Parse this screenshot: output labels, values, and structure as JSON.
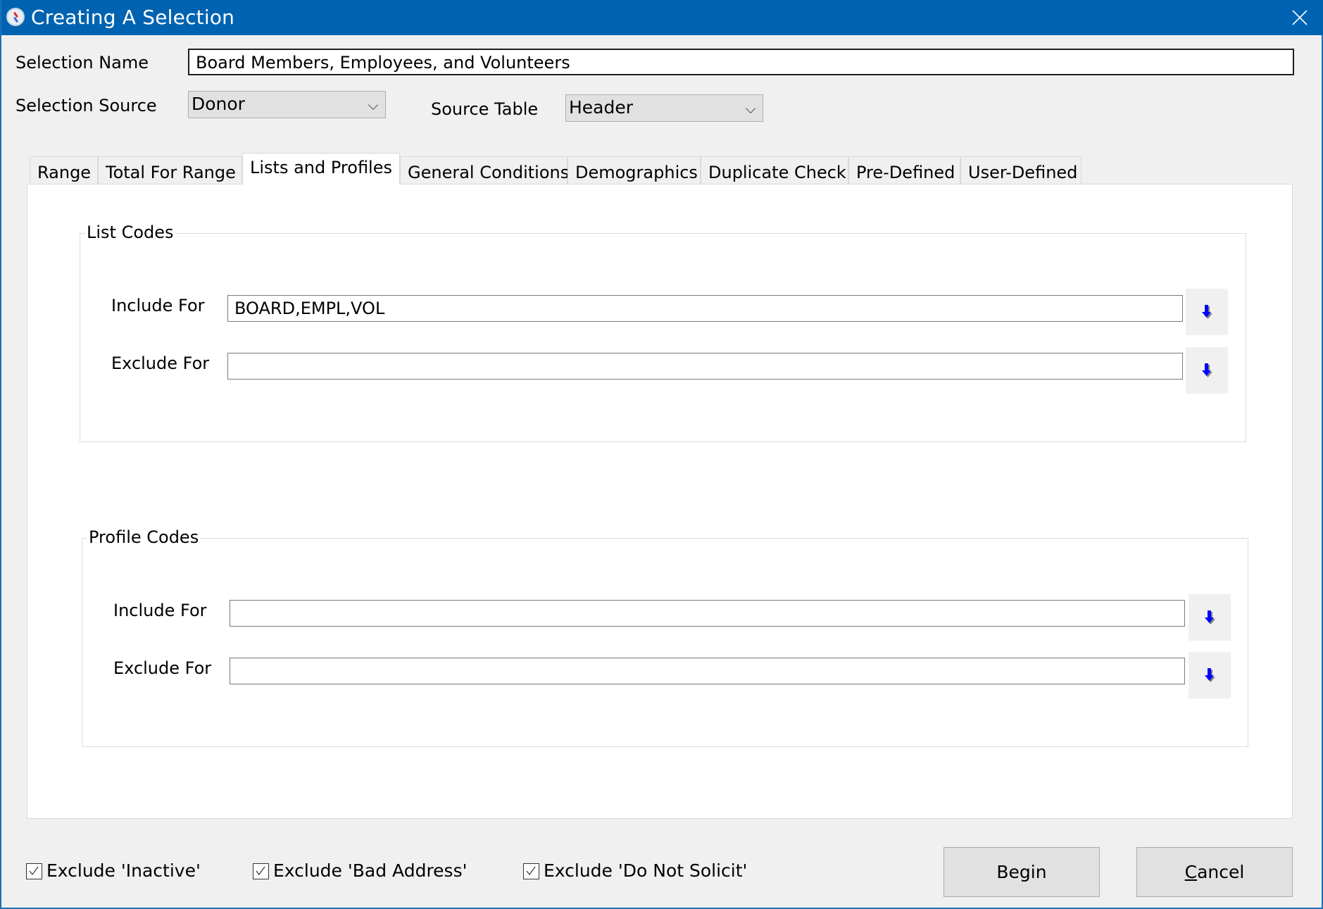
{
  "window": {
    "title": "Creating A Selection",
    "app_icon": "compass-icon",
    "close_icon": "close-icon",
    "title_bar_color": "#0063B1"
  },
  "form": {
    "selection_name_label": "Selection Name",
    "selection_name_value": "Board Members, Employees, and Volunteers",
    "selection_source_label": "Selection Source",
    "selection_source_value": "Donor",
    "source_table_label": "Source Table",
    "source_table_value": "Header"
  },
  "tabs": [
    {
      "label": "Range",
      "active": false
    },
    {
      "label": "Total For Range",
      "active": false
    },
    {
      "label": "Lists and Profiles",
      "active": true
    },
    {
      "label": "General Conditions",
      "active": false
    },
    {
      "label": "Demographics",
      "active": false
    },
    {
      "label": "Duplicate Check",
      "active": false
    },
    {
      "label": "Pre-Defined",
      "active": false
    },
    {
      "label": "User-Defined",
      "active": false
    }
  ],
  "list_codes": {
    "title": "List Codes",
    "include_label": "Include For",
    "include_value": "BOARD,EMPL,VOL",
    "exclude_label": "Exclude For",
    "exclude_value": ""
  },
  "profile_codes": {
    "title": "Profile Codes",
    "include_label": "Include For",
    "include_value": "",
    "exclude_label": "Exclude For",
    "exclude_value": ""
  },
  "options": [
    {
      "label": "Exclude 'Inactive'",
      "checked": true
    },
    {
      "label": "Exclude 'Bad Address'",
      "checked": true
    },
    {
      "label": "Exclude 'Do Not Solicit'",
      "checked": true
    }
  ],
  "buttons": {
    "begin": "Begin",
    "cancel_mnemonic": "C",
    "cancel_rest": "ancel"
  },
  "colors": {
    "arrow_icon": "#0000FF"
  }
}
